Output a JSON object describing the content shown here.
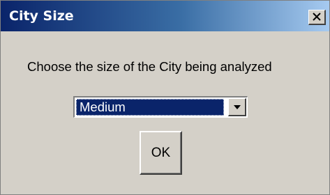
{
  "window": {
    "title": "City Size",
    "close_label": "close"
  },
  "dialog": {
    "prompt": "Choose the size of the City being analyzed",
    "size_select": {
      "selected": "Medium"
    },
    "ok_label": "OK"
  },
  "colors": {
    "titlebar_start": "#0a246a",
    "titlebar_end": "#a6caf0",
    "face": "#d4d0c8",
    "selection": "#0a246a"
  },
  "icons": {
    "close": "close-icon",
    "dropdown": "chevron-down-icon"
  }
}
